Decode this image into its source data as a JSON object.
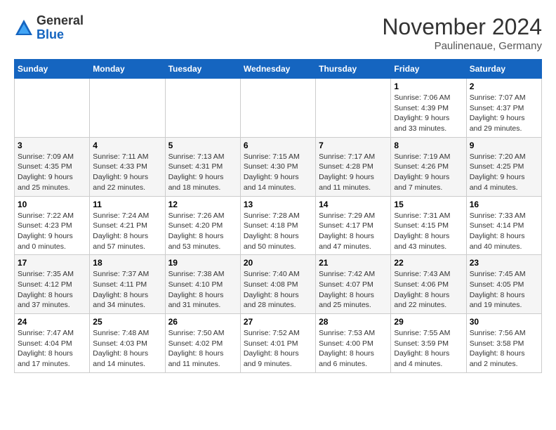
{
  "logo": {
    "general": "General",
    "blue": "Blue"
  },
  "header": {
    "month": "November 2024",
    "location": "Paulinenaue, Germany"
  },
  "weekdays": [
    "Sunday",
    "Monday",
    "Tuesday",
    "Wednesday",
    "Thursday",
    "Friday",
    "Saturday"
  ],
  "weeks": [
    [
      {
        "day": "",
        "info": ""
      },
      {
        "day": "",
        "info": ""
      },
      {
        "day": "",
        "info": ""
      },
      {
        "day": "",
        "info": ""
      },
      {
        "day": "",
        "info": ""
      },
      {
        "day": "1",
        "info": "Sunrise: 7:06 AM\nSunset: 4:39 PM\nDaylight: 9 hours\nand 33 minutes."
      },
      {
        "day": "2",
        "info": "Sunrise: 7:07 AM\nSunset: 4:37 PM\nDaylight: 9 hours\nand 29 minutes."
      }
    ],
    [
      {
        "day": "3",
        "info": "Sunrise: 7:09 AM\nSunset: 4:35 PM\nDaylight: 9 hours\nand 25 minutes."
      },
      {
        "day": "4",
        "info": "Sunrise: 7:11 AM\nSunset: 4:33 PM\nDaylight: 9 hours\nand 22 minutes."
      },
      {
        "day": "5",
        "info": "Sunrise: 7:13 AM\nSunset: 4:31 PM\nDaylight: 9 hours\nand 18 minutes."
      },
      {
        "day": "6",
        "info": "Sunrise: 7:15 AM\nSunset: 4:30 PM\nDaylight: 9 hours\nand 14 minutes."
      },
      {
        "day": "7",
        "info": "Sunrise: 7:17 AM\nSunset: 4:28 PM\nDaylight: 9 hours\nand 11 minutes."
      },
      {
        "day": "8",
        "info": "Sunrise: 7:19 AM\nSunset: 4:26 PM\nDaylight: 9 hours\nand 7 minutes."
      },
      {
        "day": "9",
        "info": "Sunrise: 7:20 AM\nSunset: 4:25 PM\nDaylight: 9 hours\nand 4 minutes."
      }
    ],
    [
      {
        "day": "10",
        "info": "Sunrise: 7:22 AM\nSunset: 4:23 PM\nDaylight: 9 hours\nand 0 minutes."
      },
      {
        "day": "11",
        "info": "Sunrise: 7:24 AM\nSunset: 4:21 PM\nDaylight: 8 hours\nand 57 minutes."
      },
      {
        "day": "12",
        "info": "Sunrise: 7:26 AM\nSunset: 4:20 PM\nDaylight: 8 hours\nand 53 minutes."
      },
      {
        "day": "13",
        "info": "Sunrise: 7:28 AM\nSunset: 4:18 PM\nDaylight: 8 hours\nand 50 minutes."
      },
      {
        "day": "14",
        "info": "Sunrise: 7:29 AM\nSunset: 4:17 PM\nDaylight: 8 hours\nand 47 minutes."
      },
      {
        "day": "15",
        "info": "Sunrise: 7:31 AM\nSunset: 4:15 PM\nDaylight: 8 hours\nand 43 minutes."
      },
      {
        "day": "16",
        "info": "Sunrise: 7:33 AM\nSunset: 4:14 PM\nDaylight: 8 hours\nand 40 minutes."
      }
    ],
    [
      {
        "day": "17",
        "info": "Sunrise: 7:35 AM\nSunset: 4:12 PM\nDaylight: 8 hours\nand 37 minutes."
      },
      {
        "day": "18",
        "info": "Sunrise: 7:37 AM\nSunset: 4:11 PM\nDaylight: 8 hours\nand 34 minutes."
      },
      {
        "day": "19",
        "info": "Sunrise: 7:38 AM\nSunset: 4:10 PM\nDaylight: 8 hours\nand 31 minutes."
      },
      {
        "day": "20",
        "info": "Sunrise: 7:40 AM\nSunset: 4:08 PM\nDaylight: 8 hours\nand 28 minutes."
      },
      {
        "day": "21",
        "info": "Sunrise: 7:42 AM\nSunset: 4:07 PM\nDaylight: 8 hours\nand 25 minutes."
      },
      {
        "day": "22",
        "info": "Sunrise: 7:43 AM\nSunset: 4:06 PM\nDaylight: 8 hours\nand 22 minutes."
      },
      {
        "day": "23",
        "info": "Sunrise: 7:45 AM\nSunset: 4:05 PM\nDaylight: 8 hours\nand 19 minutes."
      }
    ],
    [
      {
        "day": "24",
        "info": "Sunrise: 7:47 AM\nSunset: 4:04 PM\nDaylight: 8 hours\nand 17 minutes."
      },
      {
        "day": "25",
        "info": "Sunrise: 7:48 AM\nSunset: 4:03 PM\nDaylight: 8 hours\nand 14 minutes."
      },
      {
        "day": "26",
        "info": "Sunrise: 7:50 AM\nSunset: 4:02 PM\nDaylight: 8 hours\nand 11 minutes."
      },
      {
        "day": "27",
        "info": "Sunrise: 7:52 AM\nSunset: 4:01 PM\nDaylight: 8 hours\nand 9 minutes."
      },
      {
        "day": "28",
        "info": "Sunrise: 7:53 AM\nSunset: 4:00 PM\nDaylight: 8 hours\nand 6 minutes."
      },
      {
        "day": "29",
        "info": "Sunrise: 7:55 AM\nSunset: 3:59 PM\nDaylight: 8 hours\nand 4 minutes."
      },
      {
        "day": "30",
        "info": "Sunrise: 7:56 AM\nSunset: 3:58 PM\nDaylight: 8 hours\nand 2 minutes."
      }
    ]
  ]
}
